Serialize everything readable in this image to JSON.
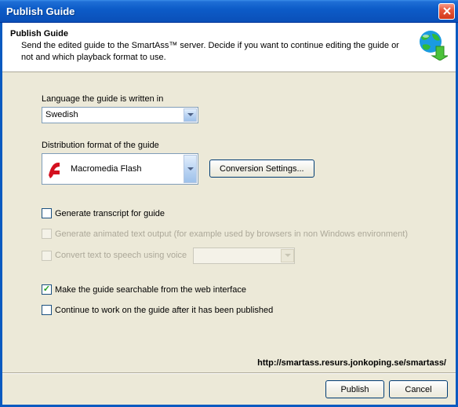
{
  "window": {
    "title": "Publish Guide"
  },
  "header": {
    "title": "Publish Guide",
    "desc": "Send the edited guide to the SmartAss™ server. Decide if you want to continue editing the guide or not and which playback format to use."
  },
  "form": {
    "language_label": "Language the guide is written in",
    "language_value": "Swedish",
    "format_label": "Distribution format of the guide",
    "format_value": "Macromedia Flash",
    "conversion_btn": "Conversion Settings...",
    "cb_transcript": "Generate transcript for guide",
    "cb_animated": "Generate animated text output (for example used by browsers in non Windows environment)",
    "cb_tts": "Convert text to speech using voice",
    "cb_searchable": "Make the guide searchable from the web interface",
    "cb_continue": "Continue to work on the guide after it has been published"
  },
  "footer": {
    "url": "http://smartass.resurs.jonkoping.se/smartass/",
    "publish": "Publish",
    "cancel": "Cancel"
  }
}
